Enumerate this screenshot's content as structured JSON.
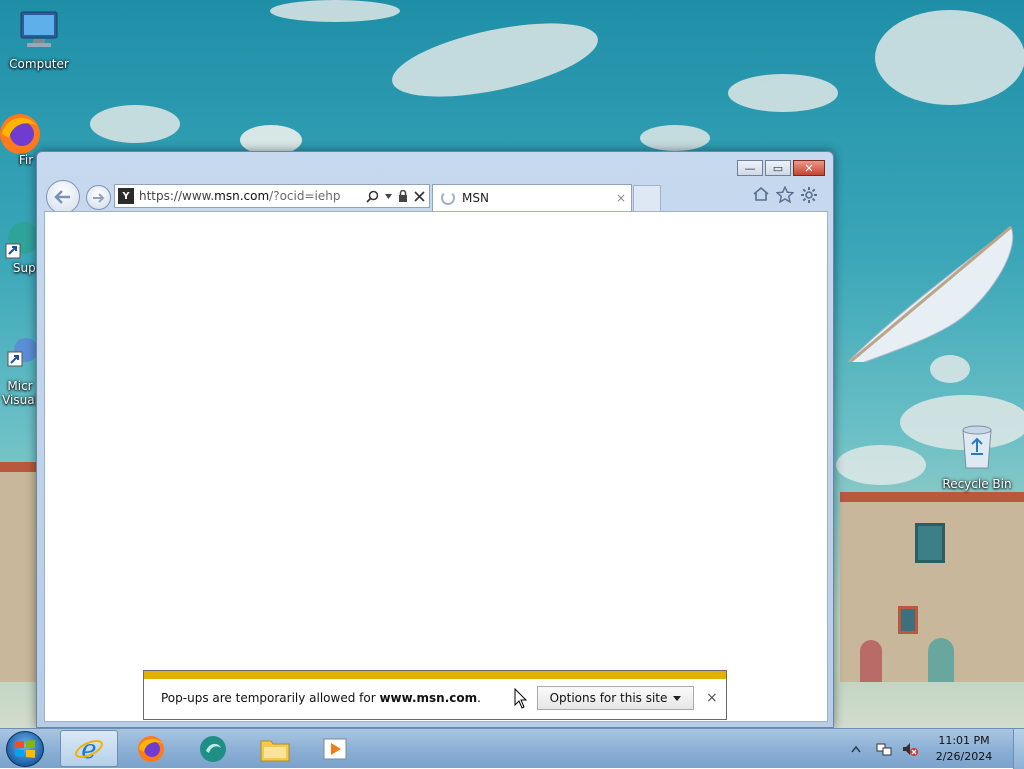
{
  "desktop": {
    "icons": [
      {
        "label": "Computer"
      },
      {
        "label": "Fir"
      },
      {
        "label": "Supe"
      },
      {
        "label": "Micr Visual"
      },
      {
        "label": "Recycle Bin"
      }
    ]
  },
  "browser": {
    "address": {
      "scheme": "https://www.",
      "host": "msn.com",
      "path": "/?ocid=iehp",
      "favicon_text": "Y"
    },
    "tab": {
      "title": "MSN",
      "close_glyph": "×"
    },
    "window_buttons": {
      "minimize": "—",
      "restore": "▭",
      "close": "✕"
    },
    "toolbar_icons": [
      "home-icon",
      "favorites-star-icon",
      "settings-gear-icon"
    ]
  },
  "notification": {
    "message_prefix": "Pop-ups are temporarily allowed for ",
    "message_site": "www.msn.com",
    "message_suffix": ".",
    "options_label": "Options for this site",
    "close_glyph": "×",
    "accent_color": "#e3b100"
  },
  "taskbar": {
    "pinned": [
      "internet-explorer",
      "firefox",
      "supercopier",
      "file-explorer",
      "media-player"
    ],
    "clock": {
      "time": "11:01 PM",
      "date": "2/26/2024"
    }
  }
}
